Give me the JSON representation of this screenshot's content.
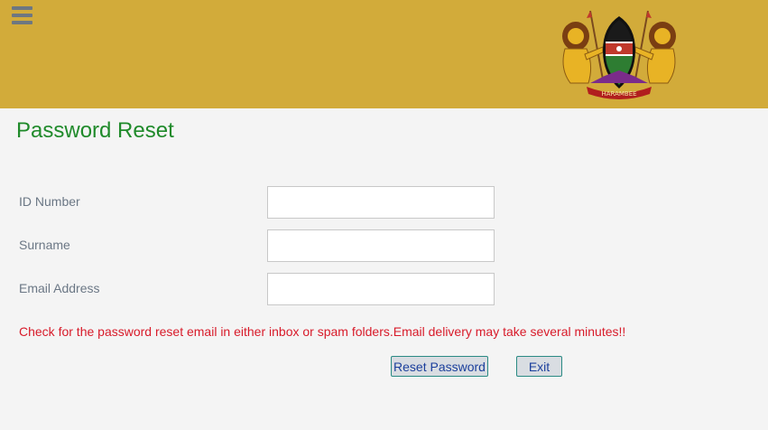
{
  "header": {
    "background_color": "#d2ab3a",
    "menu_icon": "hamburger-menu-icon",
    "logo": {
      "name": "kenya-coat-of-arms-logo",
      "motto": "HARAMBEE"
    }
  },
  "page": {
    "title": "Password Reset",
    "title_color": "#1f8a2a"
  },
  "form": {
    "fields": [
      {
        "label": "ID Number",
        "value": "",
        "placeholder": ""
      },
      {
        "label": "Surname",
        "value": "",
        "placeholder": ""
      },
      {
        "label": "Email Address",
        "value": "",
        "placeholder": ""
      }
    ],
    "notice": "Check for the password reset email in either inbox or spam folders.Email delivery may take several minutes!!",
    "notice_color": "#d81b2a",
    "buttons": {
      "reset_label": "Reset Password",
      "exit_label": "Exit"
    }
  }
}
